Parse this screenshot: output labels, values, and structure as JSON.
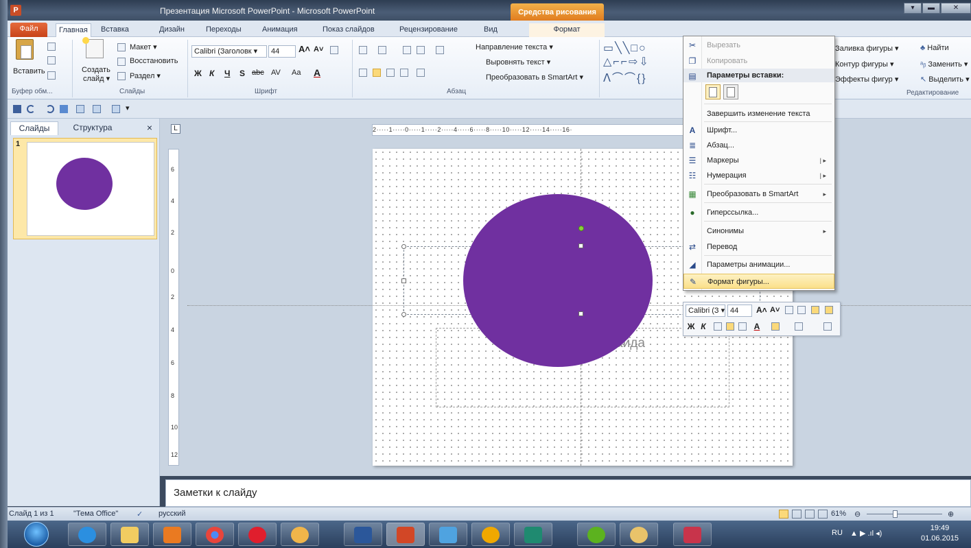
{
  "window": {
    "title": "Презентация Microsoft PowerPoint - Microsoft PowerPoint",
    "context_tools": "Средства рисования",
    "app_letter": "P",
    "buttons": [
      "▾",
      "▬",
      "✕"
    ]
  },
  "tabs": [
    "Файл",
    "Главная",
    "Вставка",
    "Дизайн",
    "Переходы",
    "Анимация",
    "Показ слайдов",
    "Рецензирование",
    "Вид",
    "Формат"
  ],
  "ribbon": {
    "clipboard": {
      "paste": "Вставить",
      "group": "Буфер обм..."
    },
    "slides": {
      "new_slide_1": "Создать",
      "new_slide_2": "слайд ▾",
      "layout": "Макет ▾",
      "reset": "Восстановить",
      "section": "Раздел ▾",
      "group": "Слайды"
    },
    "font": {
      "font_name": "Calibri (Заголовк ▾",
      "font_size": "44",
      "bold": "Ж",
      "italic": "К",
      "underline": "Ч",
      "shadow": "S",
      "strike": "abc",
      "spacing": "AV",
      "case": "Aa",
      "color": "A",
      "group": "Шрифт"
    },
    "paragraph": {
      "text_direction": "Направление текста ▾",
      "align_text": "Выровнять текст ▾",
      "smartart": "Преобразовать в SmartArt ▾",
      "group": "Абзац"
    },
    "drawing": {
      "fill": "Заливка фигуры ▾",
      "outline": "Контур фигуры ▾",
      "effects": "Эффекты фигур ▾"
    },
    "editing": {
      "find": "Найти",
      "replace": "Заменить ▾",
      "select": "Выделить ▾",
      "group": "Редактирование"
    }
  },
  "panel": {
    "tab_slides": "Слайды",
    "tab_outline": "Структура",
    "close": "×",
    "slide_number": "1"
  },
  "slide": {
    "subtitle_partial": "лайда",
    "shape_color": "#7030a0"
  },
  "ruler": {
    "horizontal": "2·····1·····0·····1·····2·····4·····6·····8·····10·····12·····14·····16·",
    "vertical": [
      "6",
      "4",
      "2",
      "0",
      "2",
      "4",
      "6",
      "8",
      "10",
      "12"
    ],
    "corner": "L"
  },
  "context_menu": {
    "cut": "Вырезать",
    "copy": "Копировать",
    "paste_options": "Параметры вставки:",
    "finish_edit": "Завершить изменение текста",
    "font": "Шрифт...",
    "paragraph": "Абзац...",
    "bullets": "Маркеры",
    "numbering": "Нумерация",
    "smartart": "Преобразовать в SmartArt",
    "hyperlink": "Гиперссылка...",
    "synonyms": "Синонимы",
    "translate": "Перевод",
    "animation": "Параметры анимации...",
    "format_shape": "Формат фигуры..."
  },
  "mini_toolbar": {
    "font": "Calibri (З ▾",
    "size": "44",
    "bold": "Ж",
    "italic": "К"
  },
  "notes": {
    "placeholder": "Заметки к слайду"
  },
  "status": {
    "slide": "Слайд 1 из 1",
    "theme": "\"Тема Office\"",
    "language": "русский",
    "zoom": "61%"
  },
  "taskbar": {
    "lang": "RU",
    "time": "19:49",
    "date": "01.06.2015"
  },
  "colors": {
    "accent": "#7030a0",
    "file_tab": "#d2522a",
    "context_tools": "#e8922c",
    "menu_highlight": "#fbe08a"
  }
}
